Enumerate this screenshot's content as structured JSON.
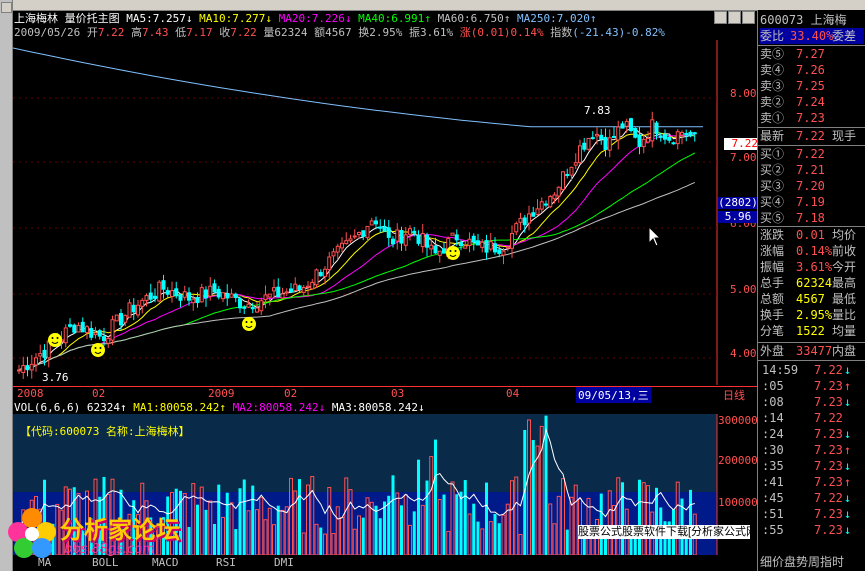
{
  "header": {
    "stock_name": "上海梅林",
    "indicator": "量价托主图",
    "ma5": "MA5:7.257",
    "ma10": "MA10:7.277",
    "ma20": "MA20:7.226",
    "ma40": "MA40:6.991",
    "ma60": "MA60:6.750",
    "ma250": "MA250:7.020",
    "down": "↓",
    "up": "↑"
  },
  "bar_info": {
    "date": "2009/05/26",
    "open_label": "开",
    "open": "7.22",
    "high_label": "高",
    "high": "7.43",
    "low_label": "低",
    "low": "7.17",
    "close_label": "收",
    "close": "7.22",
    "vol_label": "量",
    "vol": "62324",
    "amt_label": "额",
    "amt": "4567",
    "turn_label": "换",
    "turn": "2.95%",
    "amp_label": "振",
    "amp": "3.61%",
    "chg_label": "涨",
    "chg": "(0.01)0.14%",
    "idx_label": "指数",
    "idx": "(-21.43)-0.82%"
  },
  "price_axis": [
    "8.00",
    "7.00",
    "6.00",
    "5.00",
    "4.00"
  ],
  "price_badges": {
    "current": "7.22",
    "count": "(2802)",
    "level": "5.96"
  },
  "annotations": {
    "high": "7.83",
    "low": "3.76"
  },
  "date_axis": {
    "y2008": "2008",
    "m02a": "02",
    "y2009": "2009",
    "m02b": "02",
    "m03": "03",
    "m04": "04",
    "cursor": "09/05/13,三",
    "unit": "日线"
  },
  "vol_header": {
    "title": "VOL(6,6,6)",
    "value": "62324",
    "ma1": "MA1:80058.242",
    "ma2": "MA2:80058.242",
    "ma3": "MA3:80058.242",
    "up": "↑",
    "down": "↓"
  },
  "vol_label_code": "【代码:600073  名称:上海梅林】",
  "vol_axis": [
    "300000",
    "200000",
    "100000"
  ],
  "right_panel": {
    "code": "600073",
    "name": "上海梅",
    "weibi_label": "委比",
    "weibi": "33.40%",
    "weicha": "委差",
    "asks": [
      {
        "label": "卖⑤",
        "price": "7.27"
      },
      {
        "label": "卖④",
        "price": "7.26"
      },
      {
        "label": "卖③",
        "price": "7.25"
      },
      {
        "label": "卖②",
        "price": "7.24"
      },
      {
        "label": "卖①",
        "price": "7.23"
      }
    ],
    "latest_label": "最新",
    "latest": "7.22",
    "cash_label": "现手",
    "bids": [
      {
        "label": "买①",
        "price": "7.22"
      },
      {
        "label": "买②",
        "price": "7.21"
      },
      {
        "label": "买③",
        "price": "7.20"
      },
      {
        "label": "买④",
        "price": "7.19"
      },
      {
        "label": "买⑤",
        "price": "7.18"
      }
    ],
    "stats": [
      {
        "label": "涨跌",
        "value": "0.01",
        "sub": "均价"
      },
      {
        "label": "涨幅",
        "value": "0.14%",
        "sub": "前收"
      },
      {
        "label": "振幅",
        "value": "3.61%",
        "sub": "今开"
      },
      {
        "label": "总手",
        "value": "62324",
        "sub": "最高"
      },
      {
        "label": "总额",
        "value": "4567",
        "sub": "最低"
      },
      {
        "label": "换手",
        "value": "2.95%",
        "sub": "量比"
      },
      {
        "label": "分笔",
        "value": "1522",
        "sub": "均量"
      }
    ],
    "outer_label": "外盘",
    "outer": "33477",
    "inner_label": "内盘",
    "ticks": [
      {
        "t": "14:59",
        "p": "7.22",
        "d": "↓"
      },
      {
        "t": ":05",
        "p": "7.23",
        "d": "↑"
      },
      {
        "t": ":08",
        "p": "7.23",
        "d": "↓"
      },
      {
        "t": ":14",
        "p": "7.22",
        "d": ""
      },
      {
        "t": ":24",
        "p": "7.23",
        "d": "↓"
      },
      {
        "t": ":30",
        "p": "7.23",
        "d": "↑"
      },
      {
        "t": ":35",
        "p": "7.23",
        "d": "↓"
      },
      {
        "t": ":41",
        "p": "7.23",
        "d": "↑"
      },
      {
        "t": ":45",
        "p": "7.22",
        "d": "↓"
      },
      {
        "t": ":51",
        "p": "7.23",
        "d": "↓"
      },
      {
        "t": ":55",
        "p": "7.23",
        "d": "↓"
      }
    ],
    "footer": "细价盘势周指时"
  },
  "tabs": [
    "MA",
    "BOLL",
    "MACD",
    "RSI",
    "DMI"
  ],
  "logo": {
    "title": "分析家论坛",
    "url": "bbs.88gs.com"
  },
  "banner": "股票公式股票软件下载[分析家公式网www.88gs.com]",
  "colors": {
    "up": "#ff5050",
    "down": "#00ffff",
    "ma5": "#ffffff",
    "ma10": "#ffff00",
    "ma20": "#ff00ff",
    "ma40": "#00ff00",
    "ma60": "#c0c0c0",
    "ma250": "#80c0ff"
  }
}
